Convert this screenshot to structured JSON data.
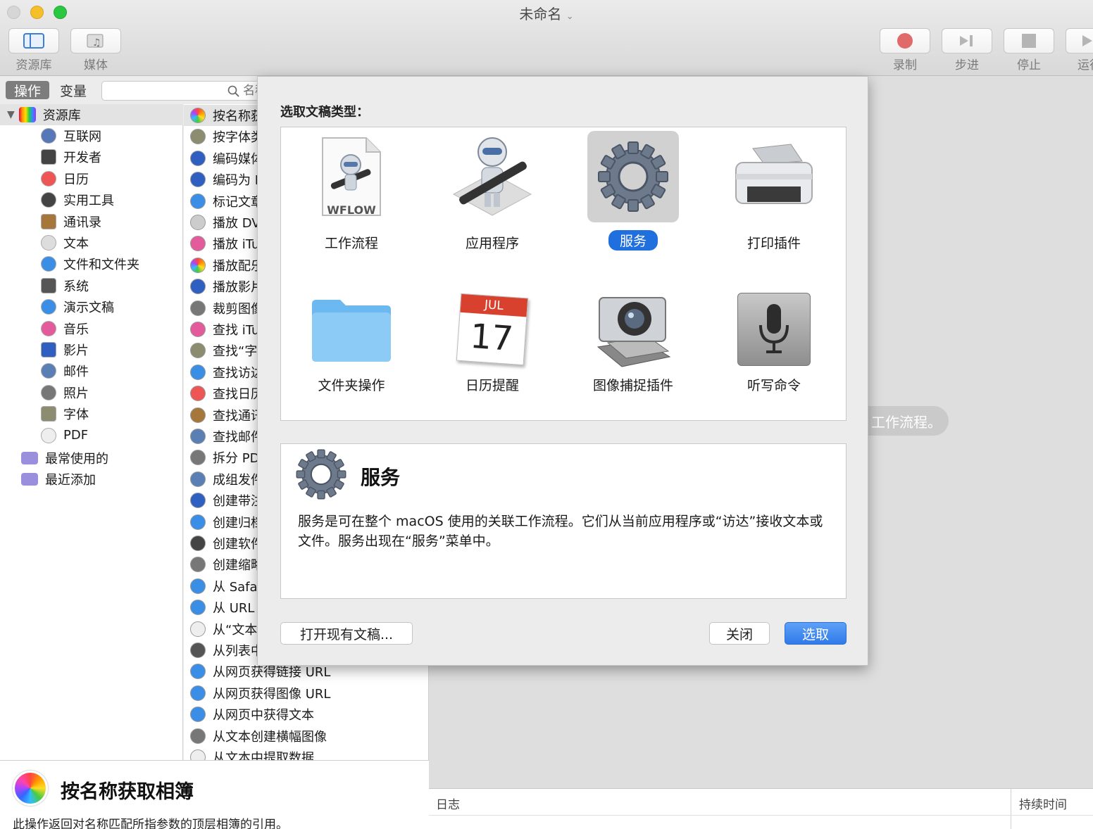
{
  "window": {
    "title": "未命名"
  },
  "toolbar": {
    "library_label": "资源库",
    "media_label": "媒体",
    "record_label": "录制",
    "step_label": "步进",
    "stop_label": "停止",
    "run_label": "运行"
  },
  "tabs": {
    "actions": "操作",
    "variables": "变量"
  },
  "search": {
    "placeholder": "名称"
  },
  "library": {
    "root": "资源库",
    "items": [
      "互联网",
      "开发者",
      "日历",
      "实用工具",
      "通讯录",
      "文本",
      "文件和文件夹",
      "系统",
      "演示文稿",
      "音乐",
      "影片",
      "邮件",
      "照片",
      "字体",
      "PDF"
    ],
    "smart": [
      "最常使用的",
      "最近添加"
    ]
  },
  "actions": {
    "items": [
      "按名称获取相簿",
      "按字体类型过滤字体",
      "编码媒体",
      "编码为 MPEG 音频",
      "标记文章",
      "播放 DVD",
      "播放 iTunes 播放列表",
      "播放配乐",
      "播放影片",
      "裁剪图像",
      "查找 iTunes 项目",
      "查找“字体簿”中的字体",
      "查找访达项目",
      "查找日历项目",
      "查找通讯录项目",
      "查找邮件项目",
      "拆分 PDF",
      "成组发件",
      "创建带注解的影片",
      "创建归档",
      "创建软件包",
      "创建缩略图",
      "从 Safari 获取文本",
      "从 URL 获取图像",
      "从“文本编辑”获取文本",
      "从列表中选择",
      "从网页获得链接 URL",
      "从网页获得图像 URL",
      "从网页中获得文本",
      "从文本创建横幅图像",
      "从文本中提取数据"
    ]
  },
  "description": {
    "title": "按名称获取相簿",
    "body": "此操作返回对名称匹配所指参数的顶层相簿的引用。"
  },
  "workflow_hint": "工作流程。",
  "log": {
    "log_col": "日志",
    "duration_col": "持续时间"
  },
  "sheet": {
    "heading": "选取文稿类型：",
    "types": [
      {
        "label": "工作流程",
        "icon": "workflow-icon"
      },
      {
        "label": "应用程序",
        "icon": "automator-robot-icon"
      },
      {
        "label": "服务",
        "icon": "gear-icon"
      },
      {
        "label": "打印插件",
        "icon": "printer-icon"
      },
      {
        "label": "文件夹操作",
        "icon": "folder-icon"
      },
      {
        "label": "日历提醒",
        "icon": "calendar-icon"
      },
      {
        "label": "图像捕捉插件",
        "icon": "camera-icon"
      },
      {
        "label": "听写命令",
        "icon": "microphone-icon"
      }
    ],
    "wflow_text": "WFLOW",
    "cal_month": "JUL",
    "cal_day": "17",
    "info_title": "服务",
    "info_body": "服务是可在整个 macOS 使用的关联工作流程。它们从当前应用程序或“访达”接收文本或文件。服务出现在“服务”菜单中。",
    "open_existing": "打开现有文稿...",
    "close": "关闭",
    "choose": "选取"
  },
  "colors": {
    "accent": "#3b82f0",
    "selection": "#1f6fde"
  }
}
